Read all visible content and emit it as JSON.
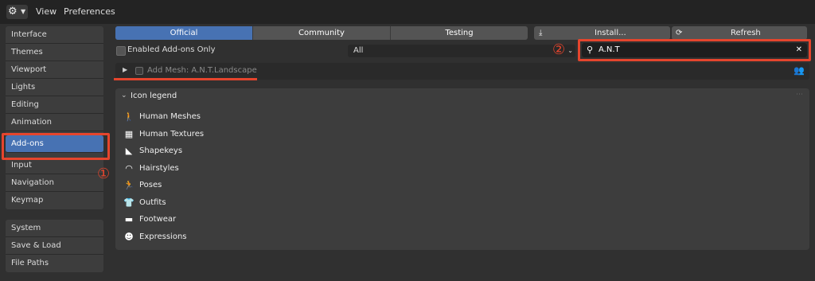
{
  "topbar": {
    "menu": [
      "View",
      "Preferences"
    ]
  },
  "sidebar": {
    "group1": [
      "Interface",
      "Themes",
      "Viewport",
      "Lights",
      "Editing",
      "Animation",
      "Add-ons",
      "Input",
      "Navigation",
      "Keymap"
    ],
    "group2": [
      "System",
      "Save & Load",
      "File Paths"
    ],
    "active": "Add-ons"
  },
  "tabs": [
    "Official",
    "Community",
    "Testing"
  ],
  "actions": {
    "install_label": "Install...",
    "refresh_label": "Refresh"
  },
  "filters": {
    "enabled_only_label": "Enabled Add-ons Only",
    "category_value": "All",
    "search_value": "A.N.T"
  },
  "addon": {
    "name": "Add Mesh: A.N.T.Landscape"
  },
  "legend": {
    "title": "Icon legend",
    "items": [
      {
        "icon": "human-meshes-icon",
        "label": "Human Meshes",
        "glyph": "🚶"
      },
      {
        "icon": "human-textures-icon",
        "label": "Human Textures",
        "glyph": "▦"
      },
      {
        "icon": "shapekeys-icon",
        "label": "Shapekeys",
        "glyph": "◣"
      },
      {
        "icon": "hairstyles-icon",
        "label": "Hairstyles",
        "glyph": "◠"
      },
      {
        "icon": "poses-icon",
        "label": "Poses",
        "glyph": "🏃"
      },
      {
        "icon": "outfits-icon",
        "label": "Outfits",
        "glyph": "👕"
      },
      {
        "icon": "footwear-icon",
        "label": "Footwear",
        "glyph": "▬"
      },
      {
        "icon": "expressions-icon",
        "label": "Expressions",
        "glyph": "☻"
      }
    ]
  },
  "annotations": {
    "marker1": "①",
    "marker2": "②",
    "highlight_color": "#e5452d"
  },
  "colors": {
    "accent": "#4772b3",
    "background": "#303030"
  }
}
